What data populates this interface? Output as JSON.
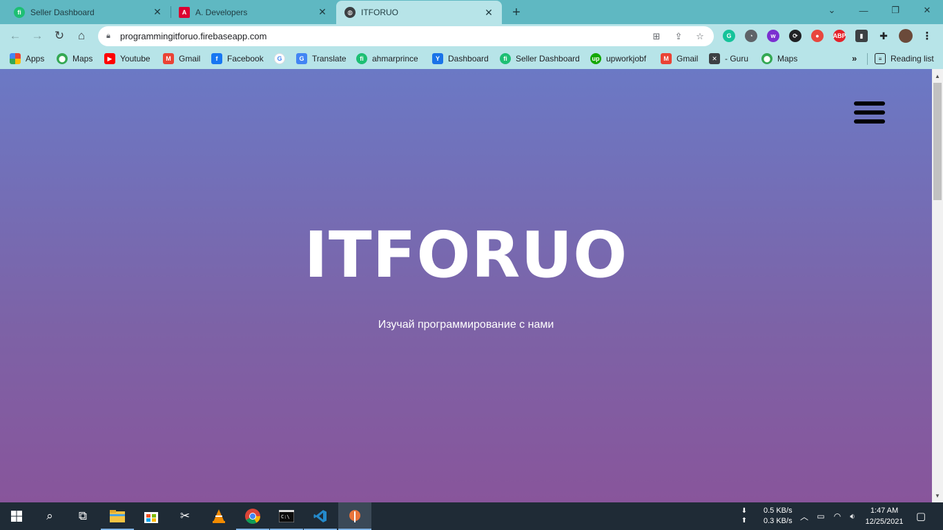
{
  "browser": {
    "tabs": [
      {
        "title": "Seller Dashboard",
        "icon": "fiverr-icon",
        "color": "#1dbf73"
      },
      {
        "title": "A. Developers",
        "icon": "angular-icon",
        "color": "#dd0031"
      },
      {
        "title": "ITFORUO",
        "icon": "globe-icon",
        "color": "#3c4043"
      }
    ],
    "tab_close": "✕",
    "new_tab": "+",
    "url": "programmingitforuo.firebaseapp.com",
    "toolbar_accent": "#b7e4e8",
    "tabstrip_color": "#5fb8c2"
  },
  "bookmarks": [
    {
      "label": "Apps",
      "icon": "apps-grid-icon"
    },
    {
      "label": "Maps",
      "icon": "maps-pin-icon"
    },
    {
      "label": "Youtube",
      "icon": "youtube-icon"
    },
    {
      "label": "Gmail",
      "icon": "gmail-icon"
    },
    {
      "label": "Facebook",
      "icon": "facebook-icon"
    },
    {
      "label": "",
      "icon": "google-icon"
    },
    {
      "label": "Translate",
      "icon": "translate-icon"
    },
    {
      "label": "ahmarprince",
      "icon": "fiverr-icon"
    },
    {
      "label": "Dashboard",
      "icon": "dashboard-icon"
    },
    {
      "label": "Seller Dashboard",
      "icon": "fiverr-icon"
    },
    {
      "label": "upworkjobf",
      "icon": "upwork-icon"
    },
    {
      "label": "Gmail",
      "icon": "gmail-icon"
    },
    {
      "label": "- Guru",
      "icon": "guru-icon"
    },
    {
      "label": "Maps",
      "icon": "maps-pin-icon"
    }
  ],
  "bookmarks_more": "»",
  "reading_list": "Reading list",
  "page": {
    "title": "ITFORUO",
    "subtitle": "Изучай программирование с нами",
    "gradient_top": "#6b79c5",
    "gradient_bottom": "#88559b"
  },
  "taskbar": {
    "net_down": "0.5 KB/s",
    "net_up": "0.3 KB/s",
    "time": "1:47 AM",
    "date": "12/25/2021"
  }
}
